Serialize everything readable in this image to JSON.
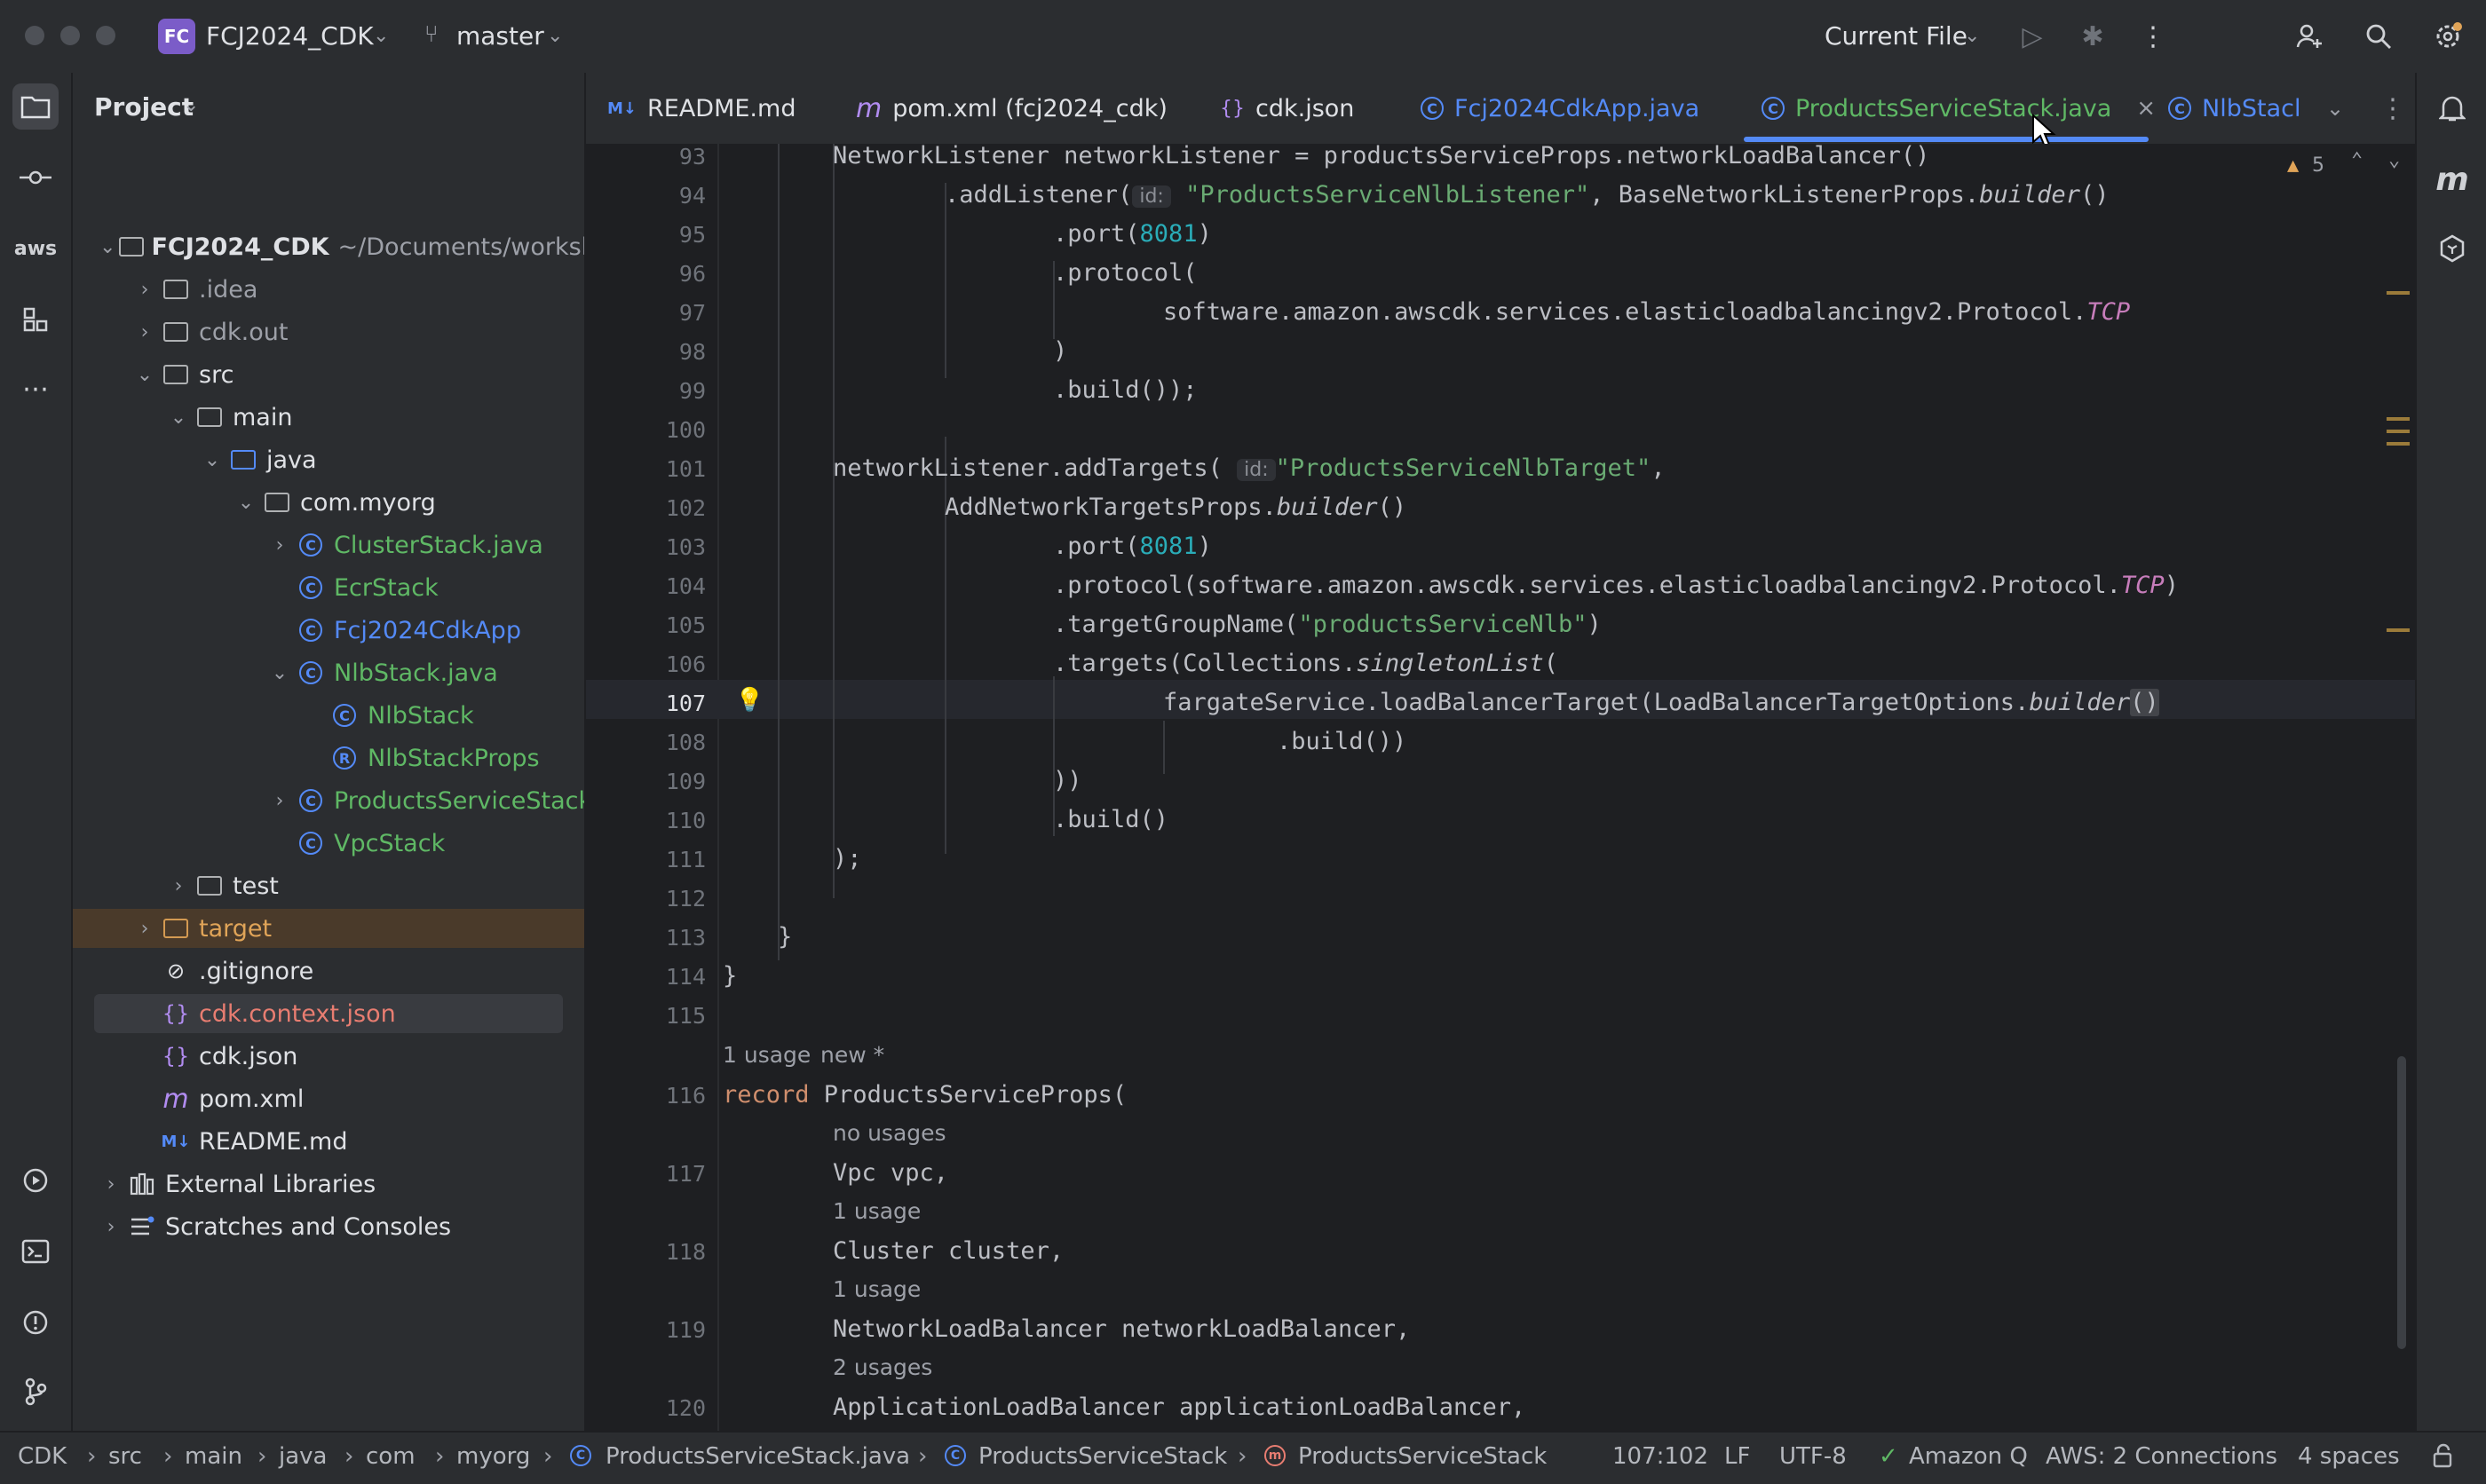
{
  "titlebar": {
    "project_badge": "FC",
    "project_name": "FCJ2024_CDK",
    "branch": "master",
    "run_config": "Current File",
    "icons": [
      "run-icon",
      "debug-icon",
      "more-icon",
      "add-user-icon",
      "search-icon",
      "settings-icon"
    ]
  },
  "project_panel": {
    "title": "Project",
    "root_name": "FCJ2024_CDK",
    "root_path": "~/Documents/worksho",
    "items": [
      {
        "label": ".idea",
        "kind": "folder"
      },
      {
        "label": "cdk.out",
        "kind": "folder"
      },
      {
        "label": "src",
        "kind": "folder"
      },
      {
        "label": "main",
        "kind": "folder"
      },
      {
        "label": "java",
        "kind": "folder"
      },
      {
        "label": "com.myorg",
        "kind": "package"
      },
      {
        "label": "ClusterStack.java",
        "kind": "class"
      },
      {
        "label": "EcrStack",
        "kind": "class"
      },
      {
        "label": "Fcj2024CdkApp",
        "kind": "class"
      },
      {
        "label": "NlbStack.java",
        "kind": "class"
      },
      {
        "label": "NlbStack",
        "kind": "class"
      },
      {
        "label": "NlbStackProps",
        "kind": "record"
      },
      {
        "label": "ProductsServiceStack.j",
        "kind": "class"
      },
      {
        "label": "VpcStack",
        "kind": "class"
      },
      {
        "label": "test",
        "kind": "folder"
      },
      {
        "label": "target",
        "kind": "folder"
      },
      {
        "label": ".gitignore",
        "kind": "ignore"
      },
      {
        "label": "cdk.context.json",
        "kind": "json"
      },
      {
        "label": "cdk.json",
        "kind": "json"
      },
      {
        "label": "pom.xml",
        "kind": "maven"
      },
      {
        "label": "README.md",
        "kind": "markdown"
      },
      {
        "label": "External Libraries",
        "kind": "libs"
      },
      {
        "label": "Scratches and Consoles",
        "kind": "scratches"
      }
    ]
  },
  "tabs": [
    {
      "label": "README.md",
      "icon": "M↓"
    },
    {
      "label": "pom.xml (fcj2024_cdk)",
      "icon": "m"
    },
    {
      "label": "cdk.json",
      "icon": "{}"
    },
    {
      "label": "Fcj2024CdkApp.java",
      "icon": "C"
    },
    {
      "label": "ProductsServiceStack.java",
      "icon": "C",
      "active": true
    },
    {
      "label": "NlbStacl",
      "icon": "C"
    }
  ],
  "editor": {
    "warnings": "5",
    "lines": [
      {
        "n": "93"
      },
      {
        "n": "94"
      },
      {
        "n": "95"
      },
      {
        "n": "96"
      },
      {
        "n": "97"
      },
      {
        "n": "98"
      },
      {
        "n": "99"
      },
      {
        "n": "100"
      },
      {
        "n": "101"
      },
      {
        "n": "102"
      },
      {
        "n": "103"
      },
      {
        "n": "104"
      },
      {
        "n": "105"
      },
      {
        "n": "106"
      },
      {
        "n": "107"
      },
      {
        "n": "108"
      },
      {
        "n": "109"
      },
      {
        "n": "110"
      },
      {
        "n": "111"
      },
      {
        "n": "112"
      },
      {
        "n": "113"
      },
      {
        "n": "114"
      },
      {
        "n": "115"
      },
      {
        "n": "116"
      },
      {
        "n": "117"
      },
      {
        "n": "118"
      },
      {
        "n": "119"
      },
      {
        "n": "120"
      }
    ],
    "hints": {
      "usage_116": "1 usage",
      "new_116": "new *",
      "usage_117": "no usages",
      "usage_118": "1 usage",
      "usage_119": "1 usage",
      "usage_120": "2 usages",
      "id_label": "id:"
    },
    "code": {
      "l93": "NetworkListener networkListener = productsServiceProps.networkLoadBalancer()",
      "l94a": ".addListener(",
      "l94b": "\"ProductsServiceNlbListener\"",
      "l94c": ", BaseNetworkListenerProps.",
      "l94d": "builder",
      "l94e": "()",
      "l95a": ".port(",
      "l95b": "8081",
      "l95c": ")",
      "l96": ".protocol(",
      "l97a": "software.amazon.awscdk.services.elasticloadbalancingv2.Protocol.",
      "l97b": "TCP",
      "l98": ")",
      "l99": ".build());",
      "l101a": "networkListener.addTargets(",
      "l101b": "\"ProductsServiceNlbTarget\"",
      "l101c": ",",
      "l102a": "AddNetworkTargetsProps.",
      "l102b": "builder",
      "l102c": "()",
      "l103a": ".port(",
      "l103b": "8081",
      "l103c": ")",
      "l104a": ".protocol(software.amazon.awscdk.services.elasticloadbalancingv2.Protocol.",
      "l104b": "TCP",
      "l104c": ")",
      "l105a": ".targetGroupName(",
      "l105b": "\"productsServiceNlb\"",
      "l105c": ")",
      "l106a": ".targets(Collections.",
      "l106b": "singletonList",
      "l106c": "(",
      "l107a": "fargateService.loadBalancerTarget(LoadBalancerTargetOptions.",
      "l107b": "builder",
      "l107c": "()",
      "l108": ".build())",
      "l109": "))",
      "l110": ".build()",
      "l111": ");",
      "l113": "}",
      "l114": "}",
      "l116a": "record",
      "l116b": " ProductsServiceProps(",
      "l117": "Vpc vpc,",
      "l118": "Cluster cluster,",
      "l119": "NetworkLoadBalancer networkLoadBalancer,",
      "l120": "ApplicationLoadBalancer applicationLoadBalancer,"
    }
  },
  "statusbar": {
    "breadcrumbs": [
      "CDK",
      "src",
      "main",
      "java",
      "com",
      "myorg",
      "ProductsServiceStack.java",
      "ProductsServiceStack",
      "ProductsServiceStack"
    ],
    "position": "107:102",
    "line_sep": "LF",
    "encoding": "UTF-8",
    "amazon_q": "Amazon Q",
    "aws": "AWS: 2 Connections",
    "indent": "4 spaces"
  },
  "colors": {
    "accent": "#548af7",
    "string": "#6aab73",
    "number": "#2aacb8",
    "keyword": "#cf8e6d"
  }
}
